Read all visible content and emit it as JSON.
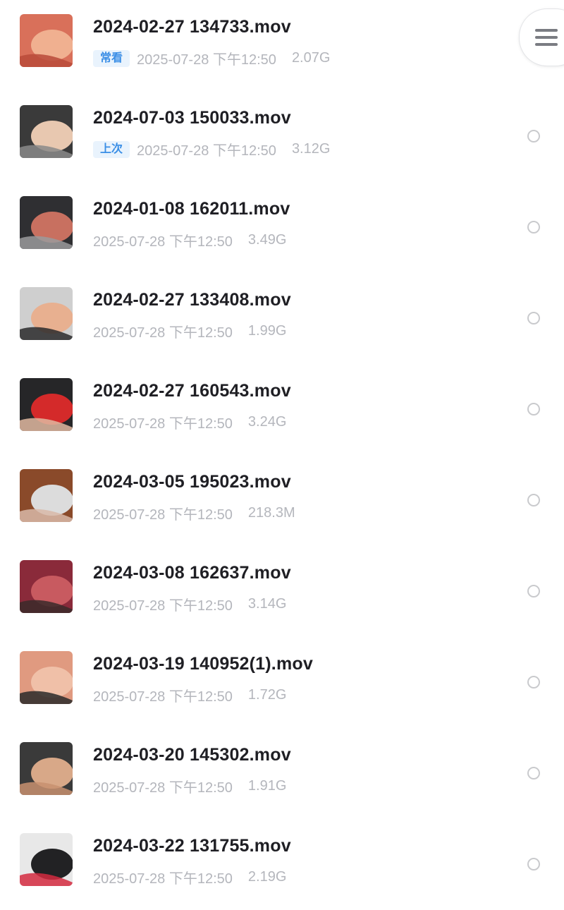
{
  "files": [
    {
      "name": "2024-02-27 134733.mov",
      "badge": "常看",
      "time": "2025-07-28 下午12:50",
      "size": "2.07G",
      "thumb": [
        "#d9705a",
        "#f0b090",
        "#b84a3a"
      ]
    },
    {
      "name": "2024-07-03 150033.mov",
      "badge": "上次",
      "time": "2025-07-28 下午12:50",
      "size": "3.12G",
      "thumb": [
        "#3a3a3a",
        "#e8c8b0",
        "#8a8a8a"
      ]
    },
    {
      "name": "2024-01-08 162011.mov",
      "time": "2025-07-28 下午12:50",
      "size": "3.49G",
      "thumb": [
        "#2f2f32",
        "#c87060",
        "#9a9a9c"
      ]
    },
    {
      "name": "2024-02-27 133408.mov",
      "time": "2025-07-28 下午12:50",
      "size": "1.99G",
      "thumb": [
        "#cfcfcf",
        "#e8b090",
        "#2a2a2c"
      ]
    },
    {
      "name": "2024-02-27 160543.mov",
      "time": "2025-07-28 下午12:50",
      "size": "3.24G",
      "thumb": [
        "#262628",
        "#d42a2a",
        "#e0b8a0"
      ]
    },
    {
      "name": "2024-03-05 195023.mov",
      "time": "2025-07-28 下午12:50",
      "size": "218.3M",
      "thumb": [
        "#8a4a2a",
        "#dcdcdc",
        "#d8b8a8"
      ]
    },
    {
      "name": "2024-03-08 162637.mov",
      "time": "2025-07-28 下午12:50",
      "size": "3.14G",
      "thumb": [
        "#8a2a3a",
        "#c85a60",
        "#3a2a2a"
      ]
    },
    {
      "name": "2024-03-19 140952(1).mov",
      "time": "2025-07-28 下午12:50",
      "size": "1.72G",
      "thumb": [
        "#e09a80",
        "#f0c0a8",
        "#2a2a2a"
      ]
    },
    {
      "name": "2024-03-20 145302.mov",
      "time": "2025-07-28 下午12:50",
      "size": "1.91G",
      "thumb": [
        "#3a3a3a",
        "#d8a888",
        "#c89070"
      ]
    },
    {
      "name": "2024-03-22 131755.mov",
      "time": "2025-07-28 下午12:50",
      "size": "2.19G",
      "thumb": [
        "#e8e8e8",
        "#222224",
        "#d42a40"
      ]
    }
  ],
  "icons": {
    "menu": "hamburger-menu-icon",
    "select": "radio-circle-icon"
  },
  "colors": {
    "badge_text": "#3a8ee6",
    "badge_bg": "#e9f3fd",
    "meta_text": "#b4b6bc"
  }
}
